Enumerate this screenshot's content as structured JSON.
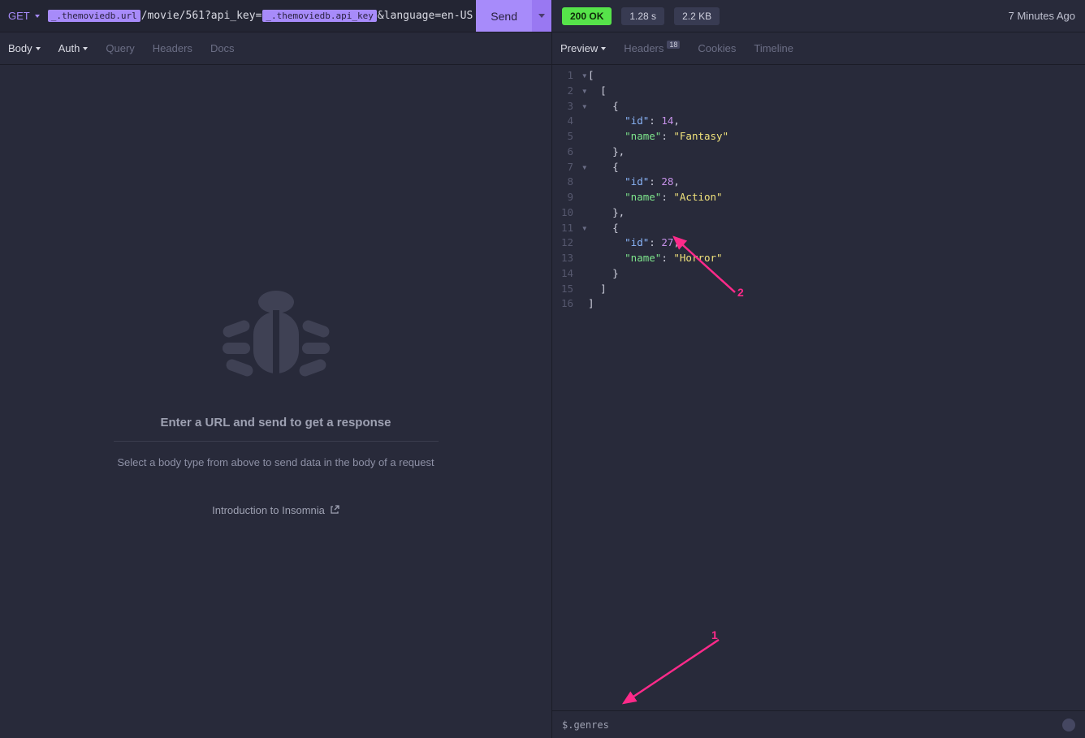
{
  "request": {
    "method": "GET",
    "url_chip1": "_.themoviedb.url",
    "url_seg1": "/movie/561?api_key=",
    "url_chip2": "_.themoviedb.api_key",
    "url_seg2": "&language=en-US",
    "send_label": "Send"
  },
  "left_tabs": {
    "body": "Body",
    "auth": "Auth",
    "query": "Query",
    "headers": "Headers",
    "docs": "Docs"
  },
  "empty": {
    "title": "Enter a URL and send to get a response",
    "subtitle": "Select a body type from above to send data in the body of a request",
    "intro": "Introduction to Insomnia"
  },
  "status": {
    "code": "200 OK",
    "time": "1.28 s",
    "size": "2.2 KB",
    "ago": "7 Minutes Ago"
  },
  "right_tabs": {
    "preview": "Preview",
    "headers": "Headers",
    "headers_badge": "18",
    "cookies": "Cookies",
    "timeline": "Timeline"
  },
  "code_lines": [
    {
      "n": 1,
      "fold": true,
      "tokens": [
        [
          "punc",
          "["
        ]
      ]
    },
    {
      "n": 2,
      "fold": true,
      "tokens": [
        [
          "ind",
          "  "
        ],
        [
          "punc",
          "["
        ]
      ]
    },
    {
      "n": 3,
      "fold": true,
      "tokens": [
        [
          "ind",
          "    "
        ],
        [
          "punc",
          "{"
        ]
      ]
    },
    {
      "n": 4,
      "tokens": [
        [
          "ind",
          "      "
        ],
        [
          "key",
          "\"id\""
        ],
        [
          "punc",
          ": "
        ],
        [
          "num",
          "14"
        ],
        [
          "punc",
          ","
        ]
      ]
    },
    {
      "n": 5,
      "tokens": [
        [
          "ind",
          "      "
        ],
        [
          "keyname",
          "\"name\""
        ],
        [
          "punc",
          ": "
        ],
        [
          "str",
          "\"Fantasy\""
        ]
      ]
    },
    {
      "n": 6,
      "tokens": [
        [
          "ind",
          "    "
        ],
        [
          "punc",
          "},"
        ]
      ]
    },
    {
      "n": 7,
      "fold": true,
      "tokens": [
        [
          "ind",
          "    "
        ],
        [
          "punc",
          "{"
        ]
      ]
    },
    {
      "n": 8,
      "tokens": [
        [
          "ind",
          "      "
        ],
        [
          "key",
          "\"id\""
        ],
        [
          "punc",
          ": "
        ],
        [
          "num",
          "28"
        ],
        [
          "punc",
          ","
        ]
      ]
    },
    {
      "n": 9,
      "tokens": [
        [
          "ind",
          "      "
        ],
        [
          "keyname",
          "\"name\""
        ],
        [
          "punc",
          ": "
        ],
        [
          "str",
          "\"Action\""
        ]
      ]
    },
    {
      "n": 10,
      "tokens": [
        [
          "ind",
          "    "
        ],
        [
          "punc",
          "},"
        ]
      ]
    },
    {
      "n": 11,
      "fold": true,
      "tokens": [
        [
          "ind",
          "    "
        ],
        [
          "punc",
          "{"
        ]
      ]
    },
    {
      "n": 12,
      "tokens": [
        [
          "ind",
          "      "
        ],
        [
          "key",
          "\"id\""
        ],
        [
          "punc",
          ": "
        ],
        [
          "num",
          "27"
        ],
        [
          "punc",
          ","
        ]
      ]
    },
    {
      "n": 13,
      "tokens": [
        [
          "ind",
          "      "
        ],
        [
          "keyname",
          "\"name\""
        ],
        [
          "punc",
          ": "
        ],
        [
          "str",
          "\"Horror\""
        ]
      ]
    },
    {
      "n": 14,
      "tokens": [
        [
          "ind",
          "    "
        ],
        [
          "punc",
          "}"
        ]
      ]
    },
    {
      "n": 15,
      "tokens": [
        [
          "ind",
          "  "
        ],
        [
          "punc",
          "]"
        ]
      ]
    },
    {
      "n": 16,
      "tokens": [
        [
          "punc",
          "]"
        ]
      ]
    }
  ],
  "filter": "$.genres",
  "annotations": {
    "label1": "1",
    "label2": "2"
  }
}
